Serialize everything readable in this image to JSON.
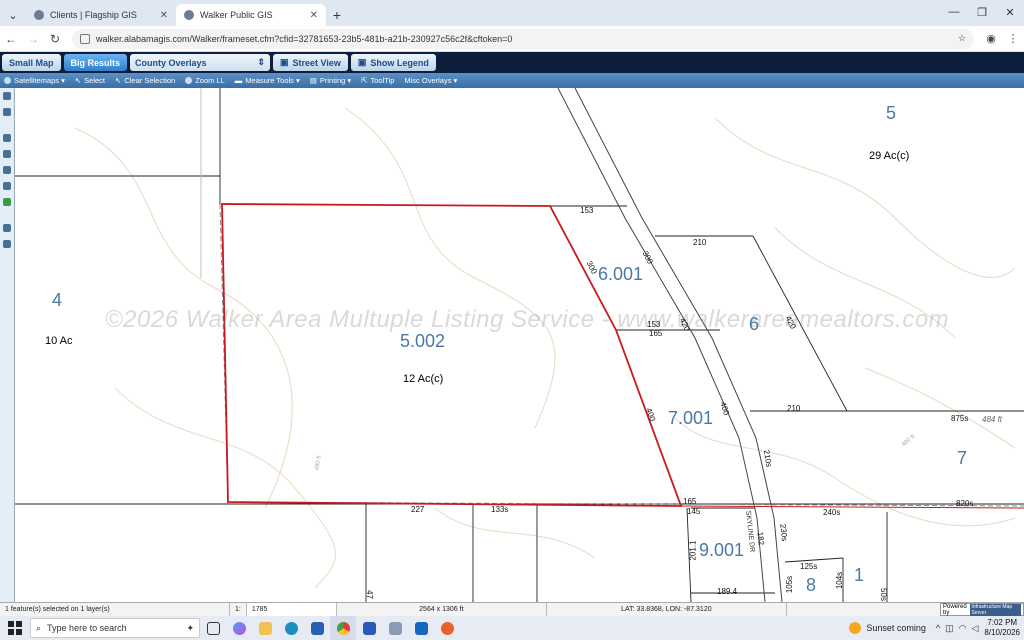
{
  "browser": {
    "tabs": [
      {
        "title": "Clients | Flagship GIS",
        "active": false
      },
      {
        "title": "Walker Public GIS",
        "active": true
      }
    ],
    "url": "walker.alabamagis.com/Walker/frameset.cfm?cfid=32781653-23b5-481b-a21b-230927c56c2f&cftoken=0"
  },
  "appbar": {
    "small_map": "Small Map",
    "big_results": "Big Results",
    "overlay_select": "County Overlays",
    "street_view": "Street View",
    "show_legend": "Show Legend"
  },
  "toolbar": {
    "items": [
      "Satellitemaps ▾",
      "Select",
      "Clear Selection",
      "Zoom LL",
      "Measure Tools ▾",
      "Printing ▾",
      "ToolTip",
      "Misc Overlays ▾"
    ]
  },
  "map": {
    "watermark": "©2026 Walker Area Multuple Listing Service - www.walkerareamealtors.com",
    "parcels": [
      {
        "id": "5",
        "acres": "29 Ac(c)"
      },
      {
        "id": "4",
        "acres": "10 Ac"
      },
      {
        "id": "5.002",
        "acres": "12 Ac(c)"
      },
      {
        "id": "6.001",
        "acres": ""
      },
      {
        "id": "6",
        "acres": ""
      },
      {
        "id": "7.001",
        "acres": ""
      },
      {
        "id": "7",
        "acres": ""
      },
      {
        "id": "9.001",
        "acres": ""
      },
      {
        "id": "8",
        "acres": ""
      },
      {
        "id": "1",
        "acres": ""
      }
    ],
    "dimensions": [
      "153",
      "300",
      "300",
      "210",
      "153",
      "165",
      "420",
      "420",
      "400",
      "400",
      "210",
      "875s",
      "484 ft",
      "210s",
      "165",
      "145",
      "820s",
      "227",
      "133s",
      "240s",
      "230s",
      "182",
      "201.1",
      "125s",
      "105s",
      "104s",
      "189.4",
      "50s",
      "47"
    ],
    "road_label": "SKYLINE DR",
    "contour_labels": [
      "480 ft",
      "480 ft"
    ]
  },
  "status": {
    "selection": "1 feature(s) selected on 1 layer(s)",
    "scale_prefix": "1:",
    "scale": "1785",
    "extent": "2564 x 1306 ft",
    "latlon": "LAT: 33.8368, LON: -87.3120",
    "powered_by": "Powered by",
    "powered_logo": "Infrastructure Map Server"
  },
  "taskbar": {
    "search_placeholder": "Type here to search",
    "weather": "Sunset coming",
    "time": "7:02 PM",
    "date": "8/10/2026"
  },
  "colors": {
    "selected_parcel": "#c8191e",
    "parcel_label": "#4a79a6",
    "contour": "#e8dcc6",
    "toolbar": "#4a80b8"
  }
}
